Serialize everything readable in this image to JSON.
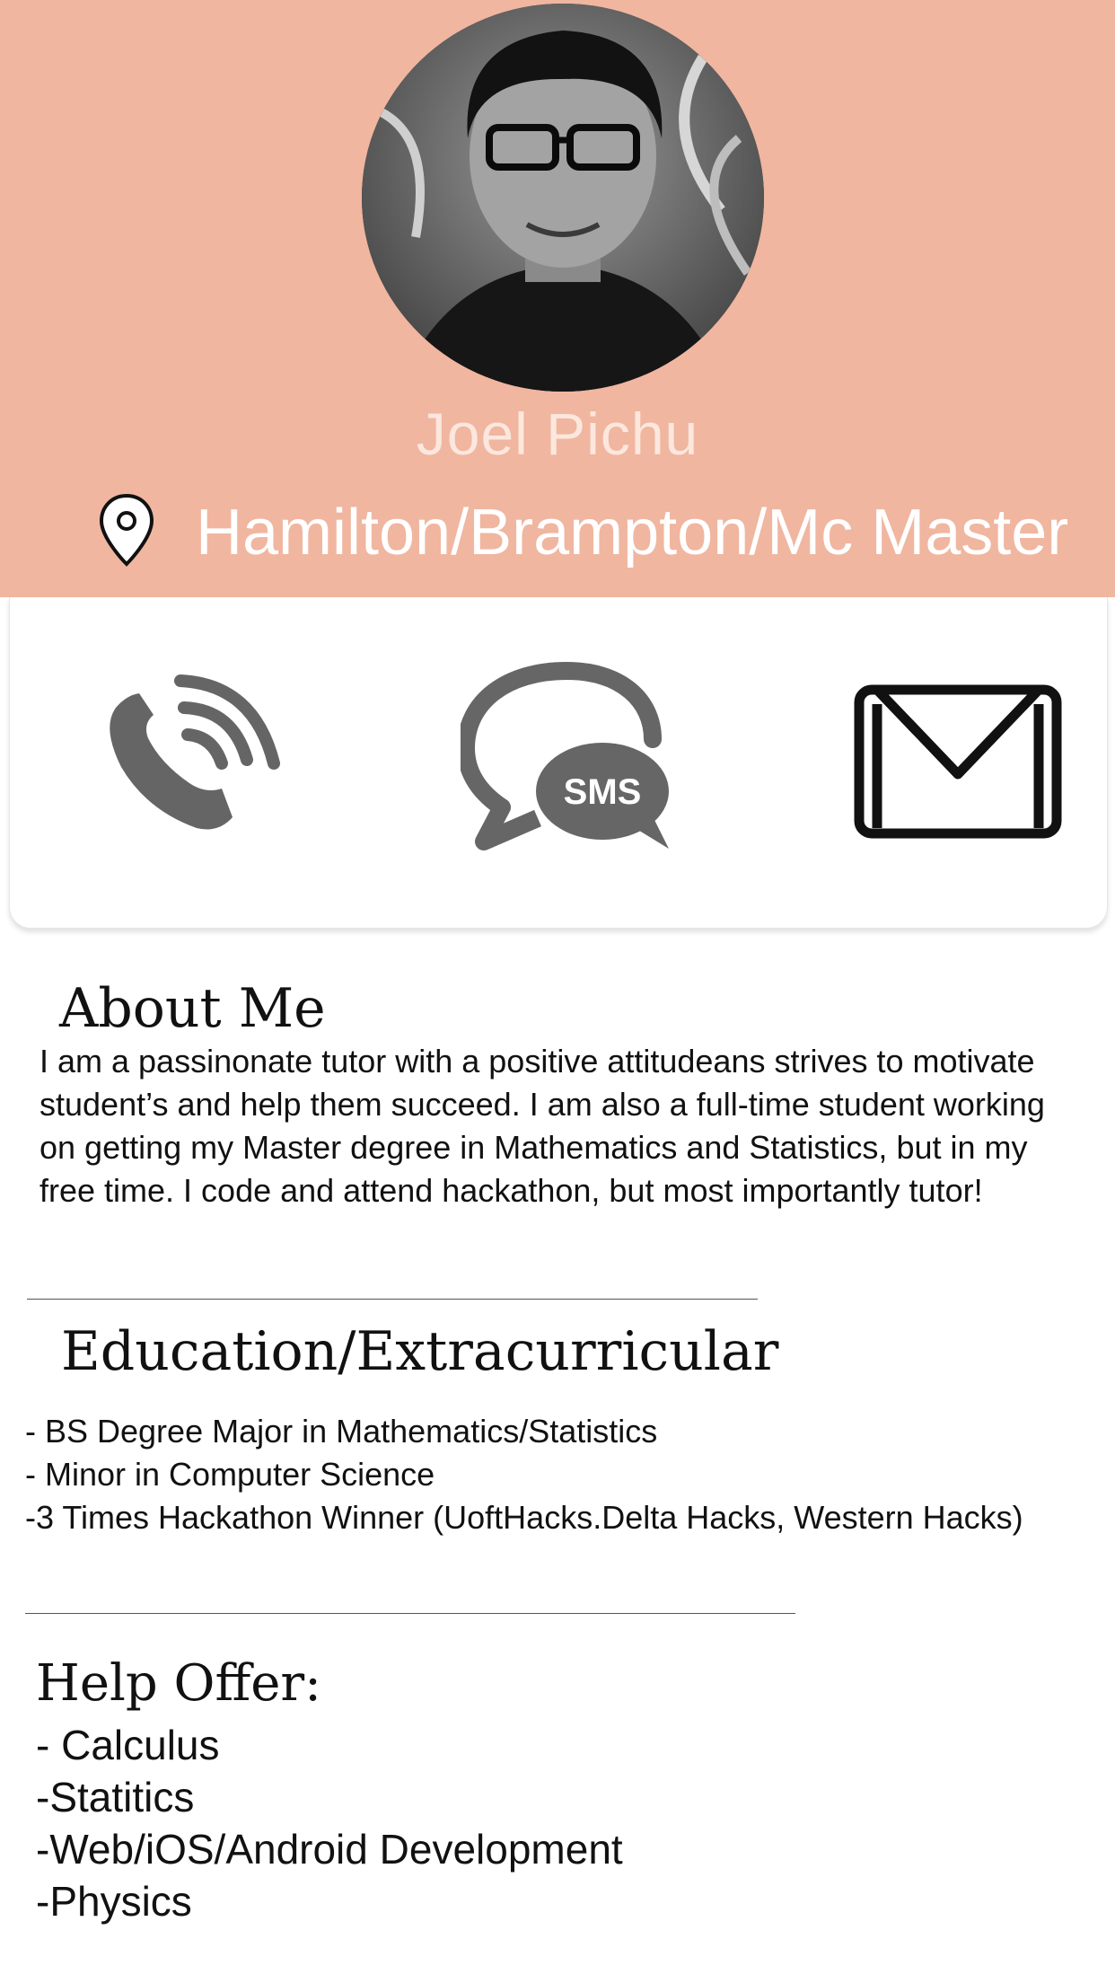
{
  "profile": {
    "name": "Joel Pichu",
    "location": "Hamilton/Brampton/Mc Master",
    "location_icon": "location-pin-icon",
    "header_color": "#f0b6a0"
  },
  "contact": {
    "phone_icon": "phone-icon",
    "sms_icon": "sms-chat-icon",
    "sms_label": "SMS",
    "mail_icon": "mail-icon"
  },
  "about": {
    "title": "About Me",
    "text": "I am a passinonate tutor with a positive attitudeans strives to motivate student’s and help them succeed. I am also a full-time student working on getting my Master degree in Mathematics and Statistics, but in my free time. I code and attend hackathon, but most importantly tutor!"
  },
  "education": {
    "title": "Education/Extracurricular",
    "items": [
      "- BS Degree Major in Mathematics/Statistics",
      "- Minor in Computer Science",
      "-3 Times Hackathon Winner (UoftHacks.Delta Hacks, Western Hacks)"
    ]
  },
  "help": {
    "title": "Help Offer:",
    "items": [
      "- Calculus",
      "-Statitics",
      "-Web/iOS/Android Development",
      "-Physics"
    ]
  }
}
